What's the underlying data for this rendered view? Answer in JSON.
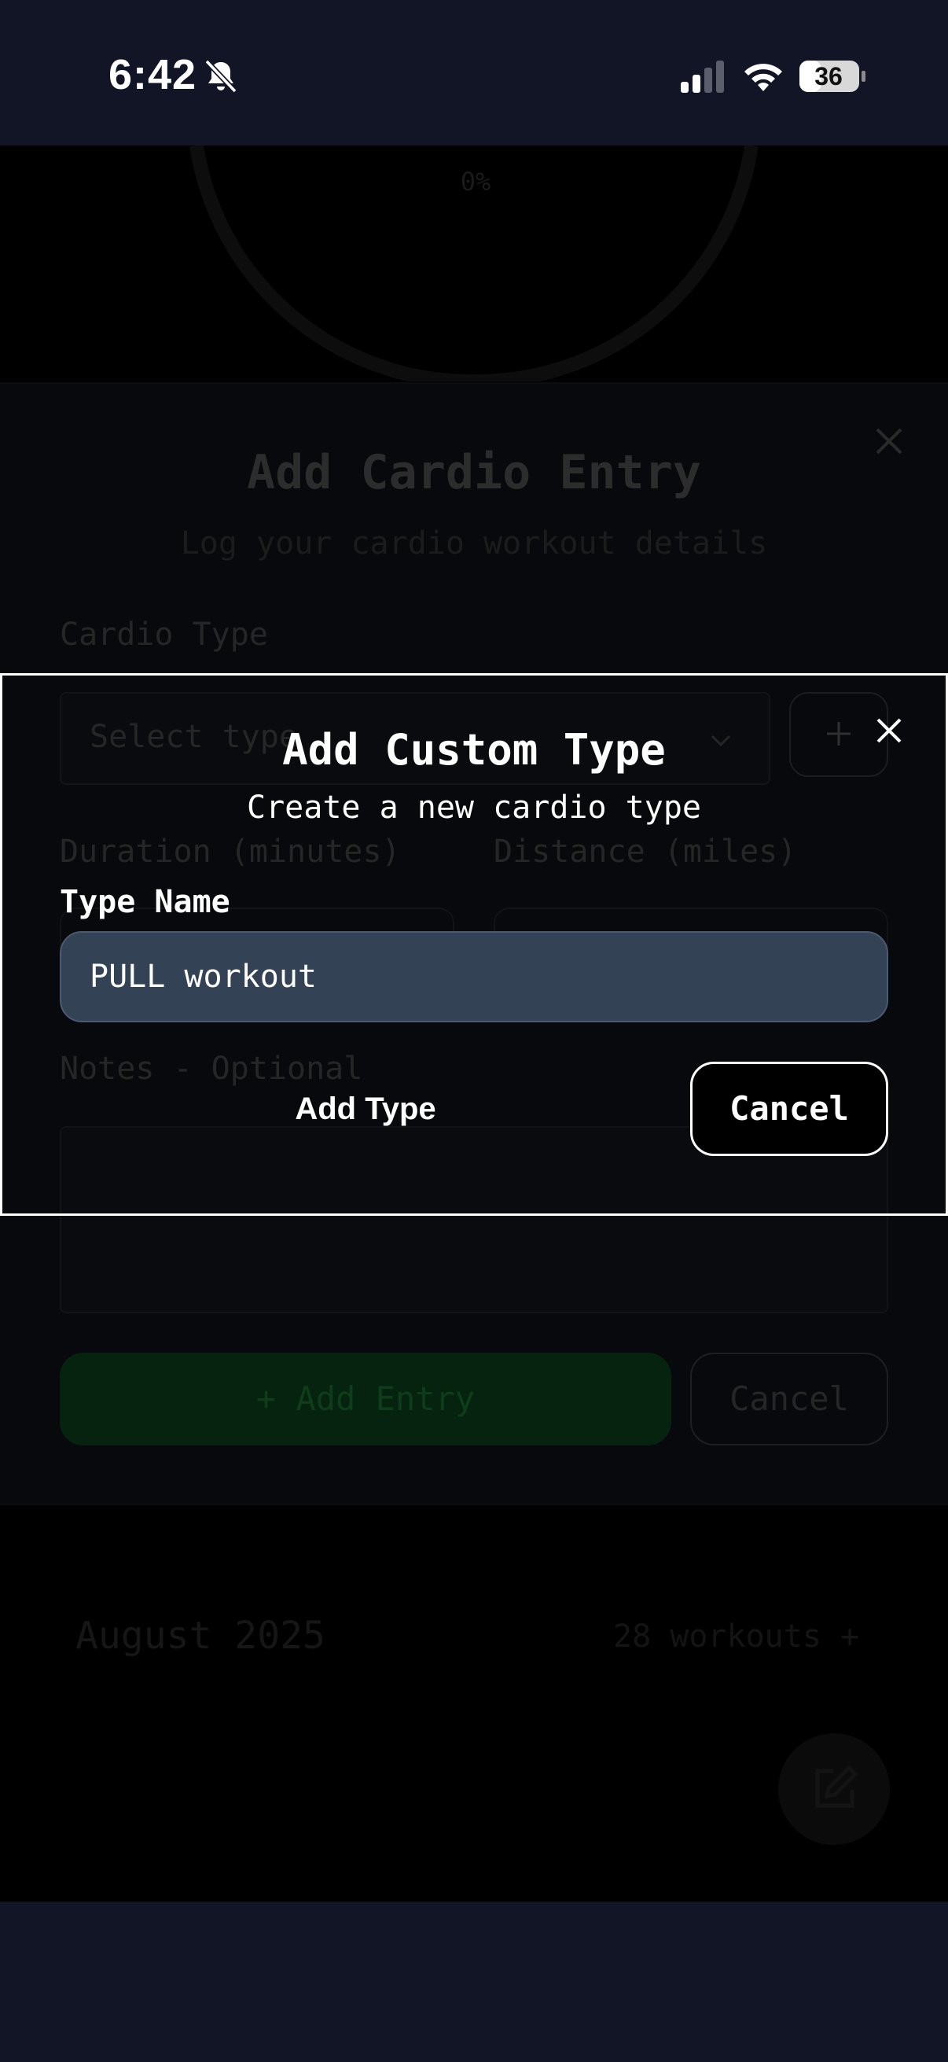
{
  "status_bar": {
    "time": "6:42",
    "battery": "36",
    "icons": [
      "bell-slash-icon",
      "signal-icon",
      "wifi-icon",
      "battery-icon"
    ]
  },
  "background": {
    "progress_percent": "0%",
    "month": "August 2025",
    "workouts": "28 workouts +",
    "fab_icon": "edit-icon"
  },
  "cardio_dialog": {
    "title": "Add Cardio Entry",
    "subtitle": "Log your cardio workout details",
    "cardio_type_label": "Cardio Type",
    "select_placeholder": "Select type",
    "add_type_button": "+",
    "duration_label": "Duration (minutes)",
    "distance_label": "Distance (miles)",
    "notes_label": "Notes - Optional",
    "add_entry_button": "+ Add Entry",
    "cancel_button": "Cancel"
  },
  "custom_type_dialog": {
    "title": "Add Custom Type",
    "subtitle": "Create a new cardio type",
    "type_name_label": "Type Name",
    "type_name_value": "PULL workout",
    "add_type_button": "Add Type",
    "cancel_button": "Cancel"
  },
  "colors": {
    "status_bg": "#111526",
    "input_bg": "#344256",
    "add_entry_green": "#06230f",
    "white": "#ffffff"
  }
}
